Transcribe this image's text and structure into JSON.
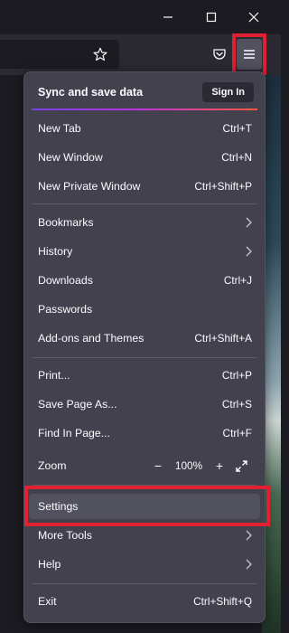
{
  "window": {
    "minimize_icon": "minimize-icon",
    "maximize_icon": "maximize-icon",
    "close_icon": "close-icon"
  },
  "toolbar": {
    "bookmark_star_icon": "star-icon",
    "pocket_icon": "pocket-icon",
    "menu_icon": "hamburger-menu-icon"
  },
  "panel": {
    "sync": {
      "title": "Sync and save data",
      "signin_label": "Sign In"
    },
    "items": [
      {
        "label": "New Tab",
        "shortcut": "Ctrl+T"
      },
      {
        "label": "New Window",
        "shortcut": "Ctrl+N"
      },
      {
        "label": "New Private Window",
        "shortcut": "Ctrl+Shift+P"
      },
      {
        "label": "Bookmarks",
        "shortcut": ""
      },
      {
        "label": "History",
        "shortcut": ""
      },
      {
        "label": "Downloads",
        "shortcut": "Ctrl+J"
      },
      {
        "label": "Passwords",
        "shortcut": ""
      },
      {
        "label": "Add-ons and Themes",
        "shortcut": "Ctrl+Shift+A"
      },
      {
        "label": "Print...",
        "shortcut": "Ctrl+P"
      },
      {
        "label": "Save Page As...",
        "shortcut": "Ctrl+S"
      },
      {
        "label": "Find In Page...",
        "shortcut": "Ctrl+F"
      },
      {
        "label": "Zoom",
        "shortcut": ""
      },
      {
        "label": "Settings",
        "shortcut": ""
      },
      {
        "label": "More Tools",
        "shortcut": ""
      },
      {
        "label": "Help",
        "shortcut": ""
      },
      {
        "label": "Exit",
        "shortcut": "Ctrl+Shift+Q"
      }
    ],
    "zoom": {
      "minus": "−",
      "value": "100%",
      "plus": "+"
    }
  },
  "colors": {
    "highlight": "#e22034",
    "panel_bg": "#42414d",
    "sync_gradient_start": "#7542e5",
    "sync_gradient_end": "#ff5a3c"
  }
}
